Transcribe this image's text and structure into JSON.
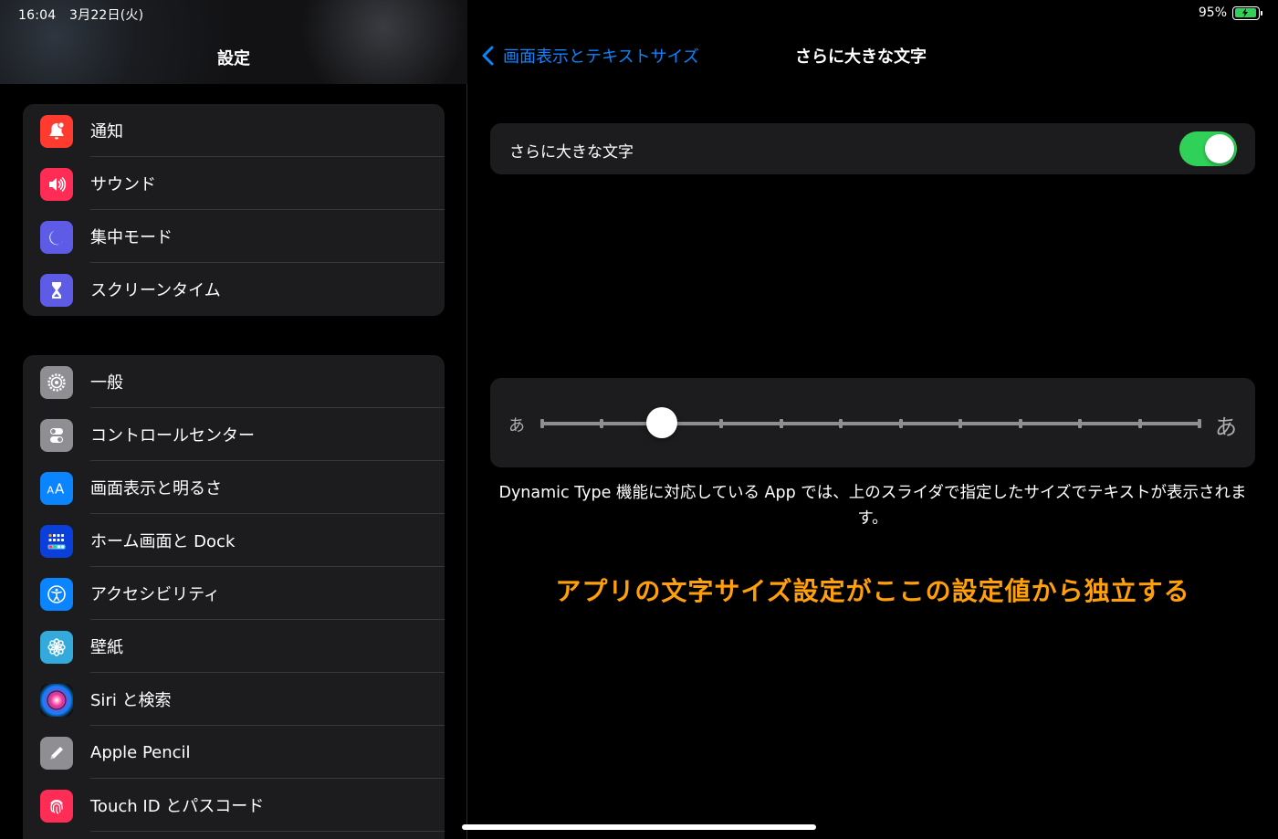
{
  "status_bar": {
    "time": "16:04",
    "date": "3月22日(火)",
    "battery": "95%"
  },
  "sidebar": {
    "title": "設定",
    "group1": [
      {
        "label": "通知",
        "icon": "bell-icon",
        "color": "#ff3b30"
      },
      {
        "label": "サウンド",
        "icon": "speaker-icon",
        "color": "#ff2d55"
      },
      {
        "label": "集中モード",
        "icon": "moon-icon",
        "color": "#5e5ce6"
      },
      {
        "label": "スクリーンタイム",
        "icon": "hourglass-icon",
        "color": "#5e5ce6"
      }
    ],
    "group2": [
      {
        "label": "一般",
        "icon": "gear-icon",
        "color": "#8e8e93"
      },
      {
        "label": "コントロールセンター",
        "icon": "switches-icon",
        "color": "#8e8e93"
      },
      {
        "label": "画面表示と明るさ",
        "icon": "text-size-icon",
        "color": "#0a84ff"
      },
      {
        "label": "ホーム画面と Dock",
        "icon": "home-grid-icon",
        "color": "#0a3fd9"
      },
      {
        "label": "アクセシビリティ",
        "icon": "accessibility-icon",
        "color": "#0a84ff"
      },
      {
        "label": "壁紙",
        "icon": "flower-icon",
        "color": "#34aadc"
      },
      {
        "label": "Siri と検索",
        "icon": "siri-icon",
        "color": "#1c1c1e"
      },
      {
        "label": "Apple Pencil",
        "icon": "pencil-icon",
        "color": "#8e8e93"
      },
      {
        "label": "Touch ID とパスコード",
        "icon": "fingerprint-icon",
        "color": "#ff2d55"
      }
    ]
  },
  "detail": {
    "back_label": "画面表示とテキストサイズ",
    "title": "さらに大きな文字",
    "toggle_label": "さらに大きな文字",
    "toggle_on": true,
    "slider": {
      "min_label": "あ",
      "max_label": "あ",
      "steps": 12,
      "value_index": 2
    },
    "footnote": "Dynamic Type 機能に対応している App では、上のスライダで指定したサイズでテキストが表示されます。",
    "annotation": "アプリの文字サイズ設定がここの設定値から独立する"
  },
  "colors": {
    "accent": "#0a84ff",
    "toggle_on": "#30d158",
    "annotation": "#ff9f0a",
    "cell_bg": "#1c1c1e"
  }
}
